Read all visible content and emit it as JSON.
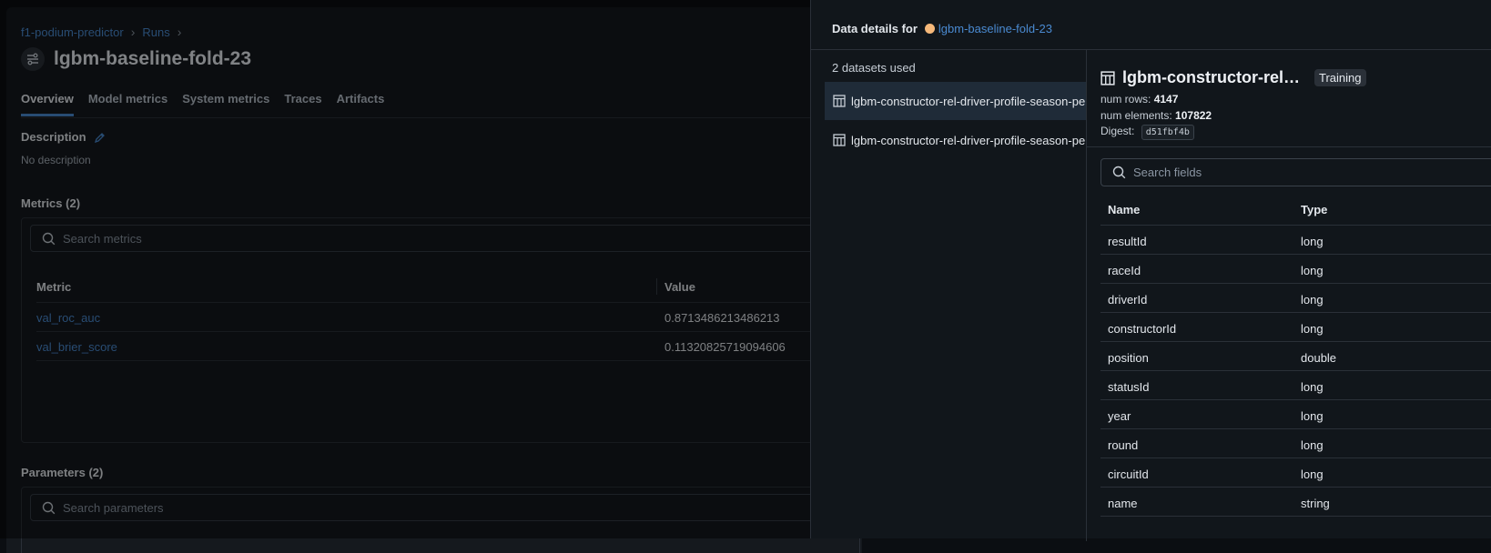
{
  "breadcrumb": {
    "experiment": "f1-podium-predictor",
    "runs": "Runs",
    "separator": "›"
  },
  "run": {
    "title": "lgbm-baseline-fold-23"
  },
  "tabs": [
    "Overview",
    "Model metrics",
    "System metrics",
    "Traces",
    "Artifacts"
  ],
  "description": {
    "label": "Description",
    "value": "No description"
  },
  "metrics": {
    "label": "Metrics (2)",
    "search_placeholder": "Search metrics",
    "columns": [
      "Metric",
      "Value"
    ],
    "rows": [
      {
        "name": "val_roc_auc",
        "value": "0.8713486213486213"
      },
      {
        "name": "val_brier_score",
        "value": "0.11320825719094606"
      }
    ]
  },
  "parameters": {
    "label": "Parameters (2)",
    "search_placeholder": "Search parameters"
  },
  "drawer": {
    "header_label": "Data details for",
    "run_link": "lgbm-baseline-fold-23",
    "dataset_count": "2 datasets used",
    "datasets": [
      "lgbm-constructor-rel-driver-profile-season-performance",
      "lgbm-constructor-rel-driver-profile-season-performance"
    ],
    "detail": {
      "title": "lgbm-constructor-rel…",
      "badge": "Training",
      "num_rows_label": "num rows:",
      "num_rows": "4147",
      "num_elements_label": "num elements:",
      "num_elements": "107822",
      "digest_label": "Digest:",
      "digest": "d51fbf4b",
      "search_placeholder": "Search fields",
      "columns": [
        "Name",
        "Type"
      ],
      "fields": [
        {
          "name": "resultId",
          "type": "long"
        },
        {
          "name": "raceId",
          "type": "long"
        },
        {
          "name": "driverId",
          "type": "long"
        },
        {
          "name": "constructorId",
          "type": "long"
        },
        {
          "name": "position",
          "type": "double"
        },
        {
          "name": "statusId",
          "type": "long"
        },
        {
          "name": "year",
          "type": "long"
        },
        {
          "name": "round",
          "type": "long"
        },
        {
          "name": "circuitId",
          "type": "long"
        },
        {
          "name": "name",
          "type": "string"
        }
      ]
    }
  },
  "colors": {
    "accent": "#4a8ad1",
    "run_dot": "#f5b87a",
    "background": "#0b0e12"
  },
  "icons": [
    "chevron-right-icon",
    "run-icon",
    "pencil-icon",
    "search-icon",
    "table-icon"
  ]
}
